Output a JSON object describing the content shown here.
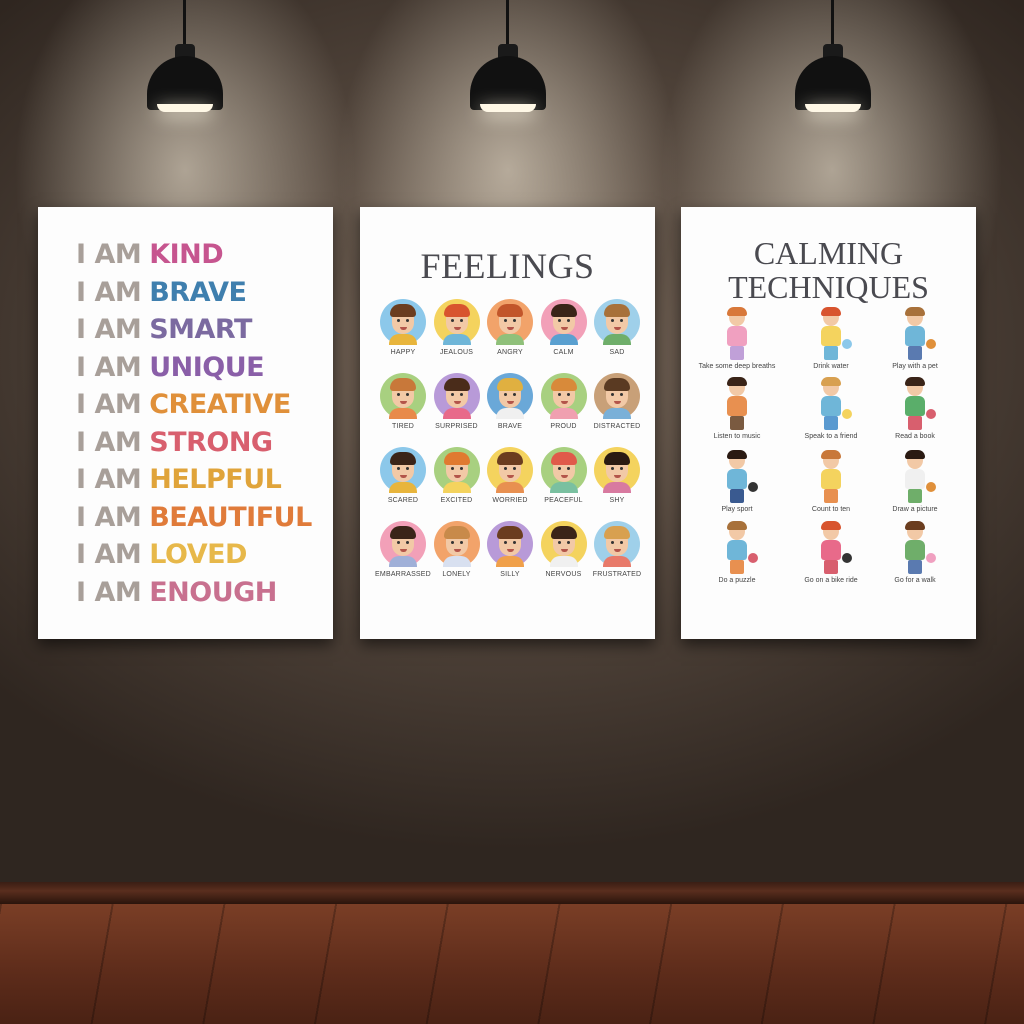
{
  "affirmations": {
    "prefix": "I AM",
    "words": [
      {
        "text": "KIND",
        "color": "#c6558f"
      },
      {
        "text": "BRAVE",
        "color": "#3f7fae"
      },
      {
        "text": "SMART",
        "color": "#7b6aa0"
      },
      {
        "text": "UNIQUE",
        "color": "#8a5fa8"
      },
      {
        "text": "CREATIVE",
        "color": "#e0903a"
      },
      {
        "text": "STRONG",
        "color": "#d85f6e"
      },
      {
        "text": "HELPFUL",
        "color": "#e0a43a"
      },
      {
        "text": "BEAUTIFUL",
        "color": "#e07b3a"
      },
      {
        "text": "LOVED",
        "color": "#e7b84a"
      },
      {
        "text": "ENOUGH",
        "color": "#c8708f"
      }
    ]
  },
  "feelings": {
    "title": "FEELINGS",
    "items": [
      {
        "label": "HAPPY",
        "bg": "#8cc8ea",
        "hair": "#6b3d1f",
        "shirt": "#e8b53c"
      },
      {
        "label": "JEALOUS",
        "bg": "#f4d35e",
        "hair": "#d8542e",
        "shirt": "#6fb6d8"
      },
      {
        "label": "ANGRY",
        "bg": "#f2a36a",
        "hair": "#c2562a",
        "shirt": "#8fc07a"
      },
      {
        "label": "CALM",
        "bg": "#f2a0b8",
        "hair": "#3a2418",
        "shirt": "#5aa0d0"
      },
      {
        "label": "SAD",
        "bg": "#9fd0ea",
        "hair": "#a8713a",
        "shirt": "#6fae6a"
      },
      {
        "label": "TIRED",
        "bg": "#a8d080",
        "hair": "#c8783a",
        "shirt": "#e88a4a"
      },
      {
        "label": "SURPRISED",
        "bg": "#b89ad8",
        "hair": "#4a2c1a",
        "shirt": "#e86a8a"
      },
      {
        "label": "BRAVE",
        "bg": "#6aa8d8",
        "hair": "#e0b040",
        "shirt": "#f0f0f0"
      },
      {
        "label": "PROUD",
        "bg": "#a8d080",
        "hair": "#d88a3a",
        "shirt": "#f0a0b0"
      },
      {
        "label": "DISTRACTED",
        "bg": "#c8a078",
        "hair": "#5a3a22",
        "shirt": "#7ab0d8"
      },
      {
        "label": "SCARED",
        "bg": "#8cc8ea",
        "hair": "#3a2418",
        "shirt": "#e8b53c"
      },
      {
        "label": "EXCITED",
        "bg": "#a8d080",
        "hair": "#e07a30",
        "shirt": "#f4d35e"
      },
      {
        "label": "WORRIED",
        "bg": "#f4d35e",
        "hair": "#6b3d1f",
        "shirt": "#e89050"
      },
      {
        "label": "PEACEFUL",
        "bg": "#a8d080",
        "hair": "#e05a4a",
        "shirt": "#7ac0a0"
      },
      {
        "label": "SHY",
        "bg": "#f4d35e",
        "hair": "#2a1a12",
        "shirt": "#d87aa0"
      },
      {
        "label": "EMBARRASSED",
        "bg": "#f2a0b8",
        "hair": "#3a2418",
        "shirt": "#a0b0d8"
      },
      {
        "label": "LONELY",
        "bg": "#f2a36a",
        "hair": "#c88a4a",
        "shirt": "#d8e0f0"
      },
      {
        "label": "SILLY",
        "bg": "#b89ad8",
        "hair": "#6b3d1f",
        "shirt": "#f0a04a"
      },
      {
        "label": "NERVOUS",
        "bg": "#f4d35e",
        "hair": "#3a2418",
        "shirt": "#f0f0f0"
      },
      {
        "label": "FRUSTRATED",
        "bg": "#9fd0ea",
        "hair": "#d8a050",
        "shirt": "#e87a6a"
      }
    ]
  },
  "calming": {
    "title_line1": "CALMING",
    "title_line2": "TECHNIQUES",
    "items": [
      {
        "label": "Take some deep breaths",
        "hair": "#d8783a",
        "shirt": "#f0a0c0",
        "legs": "#c0a0d8",
        "prop": ""
      },
      {
        "label": "Drink water",
        "hair": "#d8542e",
        "shirt": "#f4d35e",
        "legs": "#6fb6d8",
        "prop": "#8cc8ea"
      },
      {
        "label": "Play with a pet",
        "hair": "#a8713a",
        "shirt": "#6fb6d8",
        "legs": "#5a7ab0",
        "prop": "#e0903a"
      },
      {
        "label": "Listen to music",
        "hair": "#3a2418",
        "shirt": "#e89050",
        "legs": "#7a5a40",
        "prop": ""
      },
      {
        "label": "Speak to a friend",
        "hair": "#d8a050",
        "shirt": "#6fb6d8",
        "legs": "#5a9ad0",
        "prop": "#f4d35e"
      },
      {
        "label": "Read a book",
        "hair": "#3a2418",
        "shirt": "#5aae6a",
        "legs": "#d85f6e",
        "prop": "#d85f6e"
      },
      {
        "label": "Play sport",
        "hair": "#2a1a12",
        "shirt": "#6fb6d8",
        "legs": "#3a5a90",
        "prop": "#333333"
      },
      {
        "label": "Count to ten",
        "hair": "#c8783a",
        "shirt": "#f4d35e",
        "legs": "#e89050",
        "prop": ""
      },
      {
        "label": "Draw a picture",
        "hair": "#2a1a12",
        "shirt": "#f0f0f0",
        "legs": "#6fae6a",
        "prop": "#e0903a"
      },
      {
        "label": "Do a puzzle",
        "hair": "#a8713a",
        "shirt": "#6fb6d8",
        "legs": "#e89050",
        "prop": "#d85f6e"
      },
      {
        "label": "Go on a bike ride",
        "hair": "#d8542e",
        "shirt": "#e86a8a",
        "legs": "#d85f6e",
        "prop": "#333333"
      },
      {
        "label": "Go for a walk",
        "hair": "#6b3d1f",
        "shirt": "#6fae6a",
        "legs": "#5a7ab0",
        "prop": "#f0a0c0"
      }
    ]
  }
}
